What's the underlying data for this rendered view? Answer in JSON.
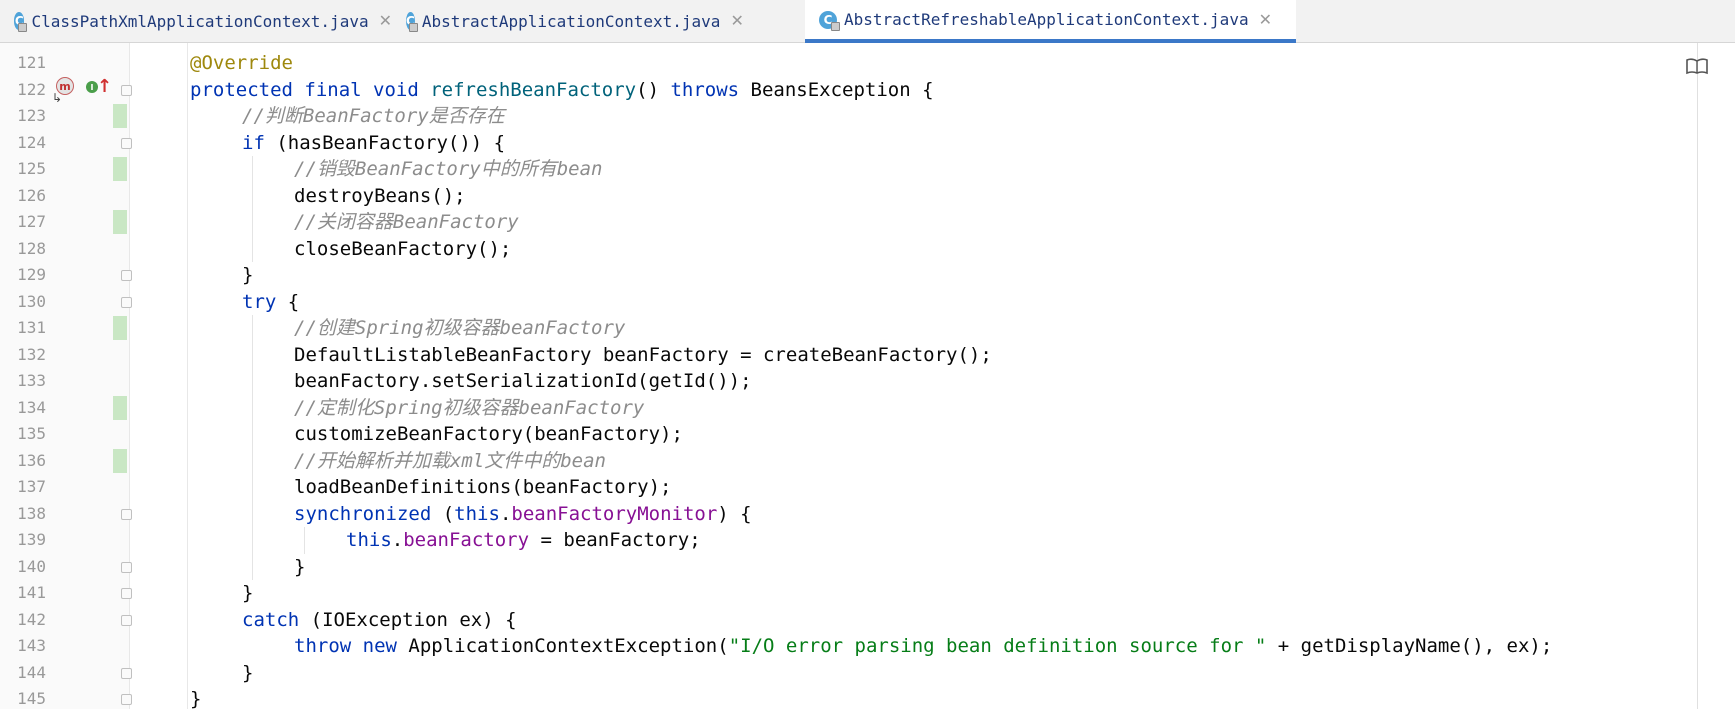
{
  "tabs": [
    {
      "title": "ClassPathXmlApplicationContext.java",
      "icon": "C",
      "close": "✕",
      "active": false
    },
    {
      "title": "AbstractApplicationContext.java",
      "icon": "C",
      "close": "✕",
      "active": false
    },
    {
      "title": "AbstractRefreshableApplicationContext.java",
      "icon": "C",
      "close": "✕",
      "active": true
    }
  ],
  "gutter": {
    "badges": {
      "override_m": "m",
      "implements_i": "I",
      "up_arrow": "↑",
      "impl_arrow": "↳"
    }
  },
  "editor": {
    "reader_mode_icon": "book-icon",
    "lines": [
      {
        "num": "121",
        "indent": 1,
        "tokens": [
          [
            "ann",
            "@Override"
          ]
        ]
      },
      {
        "num": "122",
        "indent": 1,
        "tokens": [
          [
            "kw",
            "protected final void "
          ],
          [
            "fn",
            "refreshBeanFactory"
          ],
          [
            "",
            "() "
          ],
          [
            "kw",
            "throws "
          ],
          [
            "",
            "BeansException {"
          ]
        ]
      },
      {
        "num": "123",
        "indent": 2,
        "tokens": [
          [
            "cmt",
            "//判断BeanFactory是否存在"
          ]
        ]
      },
      {
        "num": "124",
        "indent": 2,
        "tokens": [
          [
            "kw",
            "if "
          ],
          [
            "",
            "(hasBeanFactory()) {"
          ]
        ]
      },
      {
        "num": "125",
        "indent": 3,
        "tokens": [
          [
            "cmt",
            "//销毁BeanFactory中的所有bean"
          ]
        ]
      },
      {
        "num": "126",
        "indent": 3,
        "tokens": [
          [
            "",
            "destroyBeans();"
          ]
        ]
      },
      {
        "num": "127",
        "indent": 3,
        "tokens": [
          [
            "cmt",
            "//关闭容器BeanFactory"
          ]
        ]
      },
      {
        "num": "128",
        "indent": 3,
        "tokens": [
          [
            "",
            "closeBeanFactory();"
          ]
        ]
      },
      {
        "num": "129",
        "indent": 2,
        "tokens": [
          [
            "",
            "}"
          ]
        ]
      },
      {
        "num": "130",
        "indent": 2,
        "tokens": [
          [
            "kw",
            "try "
          ],
          [
            "",
            "{"
          ]
        ]
      },
      {
        "num": "131",
        "indent": 3,
        "tokens": [
          [
            "cmt",
            "//创建Spring初级容器beanFactory"
          ]
        ]
      },
      {
        "num": "132",
        "indent": 3,
        "tokens": [
          [
            "",
            "DefaultListableBeanFactory beanFactory = createBeanFactory();"
          ]
        ]
      },
      {
        "num": "133",
        "indent": 3,
        "tokens": [
          [
            "",
            "beanFactory.setSerializationId(getId());"
          ]
        ]
      },
      {
        "num": "134",
        "indent": 3,
        "tokens": [
          [
            "cmt",
            "//定制化Spring初级容器beanFactory"
          ]
        ]
      },
      {
        "num": "135",
        "indent": 3,
        "tokens": [
          [
            "",
            "customizeBeanFactory(beanFactory);"
          ]
        ]
      },
      {
        "num": "136",
        "indent": 3,
        "tokens": [
          [
            "cmt",
            "//开始解析并加载xml文件中的bean"
          ]
        ]
      },
      {
        "num": "137",
        "indent": 3,
        "tokens": [
          [
            "",
            "loadBeanDefinitions(beanFactory);"
          ]
        ]
      },
      {
        "num": "138",
        "indent": 3,
        "tokens": [
          [
            "kw",
            "synchronized "
          ],
          [
            "",
            "("
          ],
          [
            "kw",
            "this"
          ],
          [
            "",
            "."
          ],
          [
            "fld",
            "beanFactoryMonitor"
          ],
          [
            "",
            ") {"
          ]
        ]
      },
      {
        "num": "139",
        "indent": 4,
        "tokens": [
          [
            "kw",
            "this"
          ],
          [
            "",
            "."
          ],
          [
            "fld",
            "beanFactory"
          ],
          [
            "",
            " = beanFactory;"
          ]
        ]
      },
      {
        "num": "140",
        "indent": 3,
        "tokens": [
          [
            "",
            "}"
          ]
        ]
      },
      {
        "num": "141",
        "indent": 2,
        "tokens": [
          [
            "",
            "}"
          ]
        ]
      },
      {
        "num": "142",
        "indent": 2,
        "tokens": [
          [
            "kw",
            "catch "
          ],
          [
            "",
            "(IOException ex) {"
          ]
        ]
      },
      {
        "num": "143",
        "indent": 3,
        "tokens": [
          [
            "kw",
            "throw new "
          ],
          [
            "",
            "ApplicationContextException("
          ],
          [
            "str",
            "\"I/O error parsing bean definition source for \""
          ],
          [
            "",
            " + getDisplayName(), ex);"
          ]
        ]
      },
      {
        "num": "144",
        "indent": 2,
        "tokens": [
          [
            "",
            "}"
          ]
        ]
      },
      {
        "num": "145",
        "indent": 1,
        "tokens": [
          [
            "",
            "}"
          ]
        ]
      }
    ],
    "modified_lines": [
      "123",
      "125",
      "127",
      "131",
      "134",
      "136"
    ],
    "fold_markers": [
      "122",
      "124",
      "129",
      "130",
      "138",
      "140",
      "141",
      "142",
      "144",
      "145"
    ]
  },
  "colors": {
    "keyword": "#0033b3",
    "annotation": "#9e880d",
    "method_decl": "#00627a",
    "field": "#871094",
    "string": "#067d17",
    "comment": "#8c8c8c",
    "modified_marker": "#c9e7c4",
    "active_tab_underline": "#3b78c8"
  }
}
